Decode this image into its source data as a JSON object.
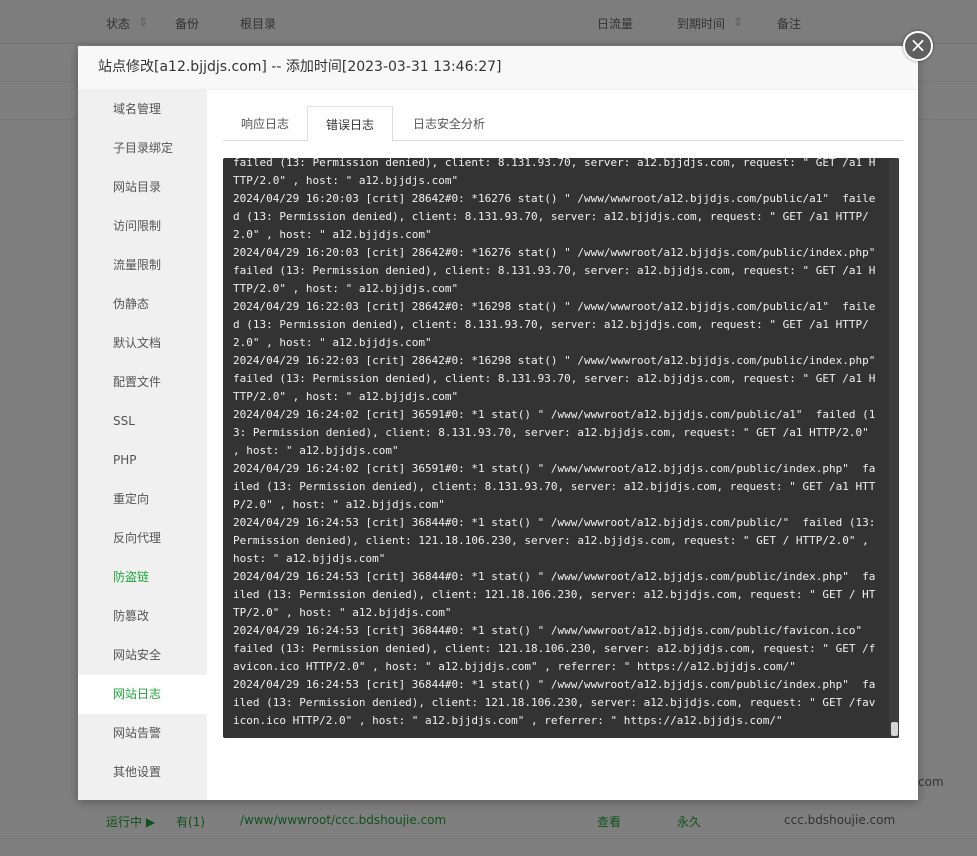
{
  "background_table": {
    "headers": [
      "状态",
      "备份",
      "根目录",
      "日流量",
      "到期时间",
      "备注"
    ],
    "rows": [
      {
        "status": "运行中 ▶",
        "backup": "有(1)",
        "root": "/www/wwwroot/ccc.bdshoujie.com",
        "traffic": "查看",
        "expire": "永久",
        "remark": "ccc.bdshoujie.com"
      }
    ],
    "partial_remark": "com"
  },
  "modal": {
    "title": "站点修改[a12.bjjdjs.com] -- 添加时间[2023-03-31 13:46:27]",
    "close_icon": "×"
  },
  "sidebar": {
    "items": [
      {
        "label": "域名管理"
      },
      {
        "label": "子目录绑定"
      },
      {
        "label": "网站目录"
      },
      {
        "label": "访问限制"
      },
      {
        "label": "流量限制"
      },
      {
        "label": "伪静态"
      },
      {
        "label": "默认文档"
      },
      {
        "label": "配置文件"
      },
      {
        "label": "SSL"
      },
      {
        "label": "PHP"
      },
      {
        "label": "重定向"
      },
      {
        "label": "反向代理"
      },
      {
        "label": "防盗链"
      },
      {
        "label": "防篡改"
      },
      {
        "label": "网站安全"
      },
      {
        "label": "网站日志"
      },
      {
        "label": "网站告警"
      },
      {
        "label": "其他设置"
      }
    ],
    "active_index": 15
  },
  "tabs": [
    {
      "label": "响应日志"
    },
    {
      "label": "错误日志"
    },
    {
      "label": "日志安全分析"
    }
  ],
  "active_tab": 1,
  "log": {
    "text": "failed (13: Permission denied), client: 8.131.93.70, server: a12.bjjdjs.com, request: \" GET /a1 HTTP/2.0\" , host: \" a12.bjjdjs.com\"\n2024/04/29 16:20:03 [crit] 28642#0: *16276 stat() \" /www/wwwroot/a12.bjjdjs.com/public/a1\"  failed (13: Permission denied), client: 8.131.93.70, server: a12.bjjdjs.com, request: \" GET /a1 HTTP/2.0\" , host: \" a12.bjjdjs.com\"\n2024/04/29 16:20:03 [crit] 28642#0: *16276 stat() \" /www/wwwroot/a12.bjjdjs.com/public/index.php\"  failed (13: Permission denied), client: 8.131.93.70, server: a12.bjjdjs.com, request: \" GET /a1 HTTP/2.0\" , host: \" a12.bjjdjs.com\"\n2024/04/29 16:22:03 [crit] 28642#0: *16298 stat() \" /www/wwwroot/a12.bjjdjs.com/public/a1\"  failed (13: Permission denied), client: 8.131.93.70, server: a12.bjjdjs.com, request: \" GET /a1 HTTP/2.0\" , host: \" a12.bjjdjs.com\"\n2024/04/29 16:22:03 [crit] 28642#0: *16298 stat() \" /www/wwwroot/a12.bjjdjs.com/public/index.php\"  failed (13: Permission denied), client: 8.131.93.70, server: a12.bjjdjs.com, request: \" GET /a1 HTTP/2.0\" , host: \" a12.bjjdjs.com\"\n2024/04/29 16:24:02 [crit] 36591#0: *1 stat() \" /www/wwwroot/a12.bjjdjs.com/public/a1\"  failed (13: Permission denied), client: 8.131.93.70, server: a12.bjjdjs.com, request: \" GET /a1 HTTP/2.0\" , host: \" a12.bjjdjs.com\"\n2024/04/29 16:24:02 [crit] 36591#0: *1 stat() \" /www/wwwroot/a12.bjjdjs.com/public/index.php\"  failed (13: Permission denied), client: 8.131.93.70, server: a12.bjjdjs.com, request: \" GET /a1 HTTP/2.0\" , host: \" a12.bjjdjs.com\"\n2024/04/29 16:24:53 [crit] 36844#0: *1 stat() \" /www/wwwroot/a12.bjjdjs.com/public/\"  failed (13: Permission denied), client: 121.18.106.230, server: a12.bjjdjs.com, request: \" GET / HTTP/2.0\" , host: \" a12.bjjdjs.com\"\n2024/04/29 16:24:53 [crit] 36844#0: *1 stat() \" /www/wwwroot/a12.bjjdjs.com/public/index.php\"  failed (13: Permission denied), client: 121.18.106.230, server: a12.bjjdjs.com, request: \" GET / HTTP/2.0\" , host: \" a12.bjjdjs.com\"\n2024/04/29 16:24:53 [crit] 36844#0: *1 stat() \" /www/wwwroot/a12.bjjdjs.com/public/favicon.ico\"  failed (13: Permission denied), client: 121.18.106.230, server: a12.bjjdjs.com, request: \" GET /favicon.ico HTTP/2.0\" , host: \" a12.bjjdjs.com\" , referrer: \" https://a12.bjjdjs.com/\"\n2024/04/29 16:24:53 [crit] 36844#0: *1 stat() \" /www/wwwroot/a12.bjjdjs.com/public/index.php\"  failed (13: Permission denied), client: 121.18.106.230, server: a12.bjjdjs.com, request: \" GET /favicon.ico HTTP/2.0\" , host: \" a12.bjjdjs.com\" , referrer: \" https://a12.bjjdjs.com/\""
  },
  "colors": {
    "accent_green": "#20a53a",
    "log_background": "#333333"
  }
}
